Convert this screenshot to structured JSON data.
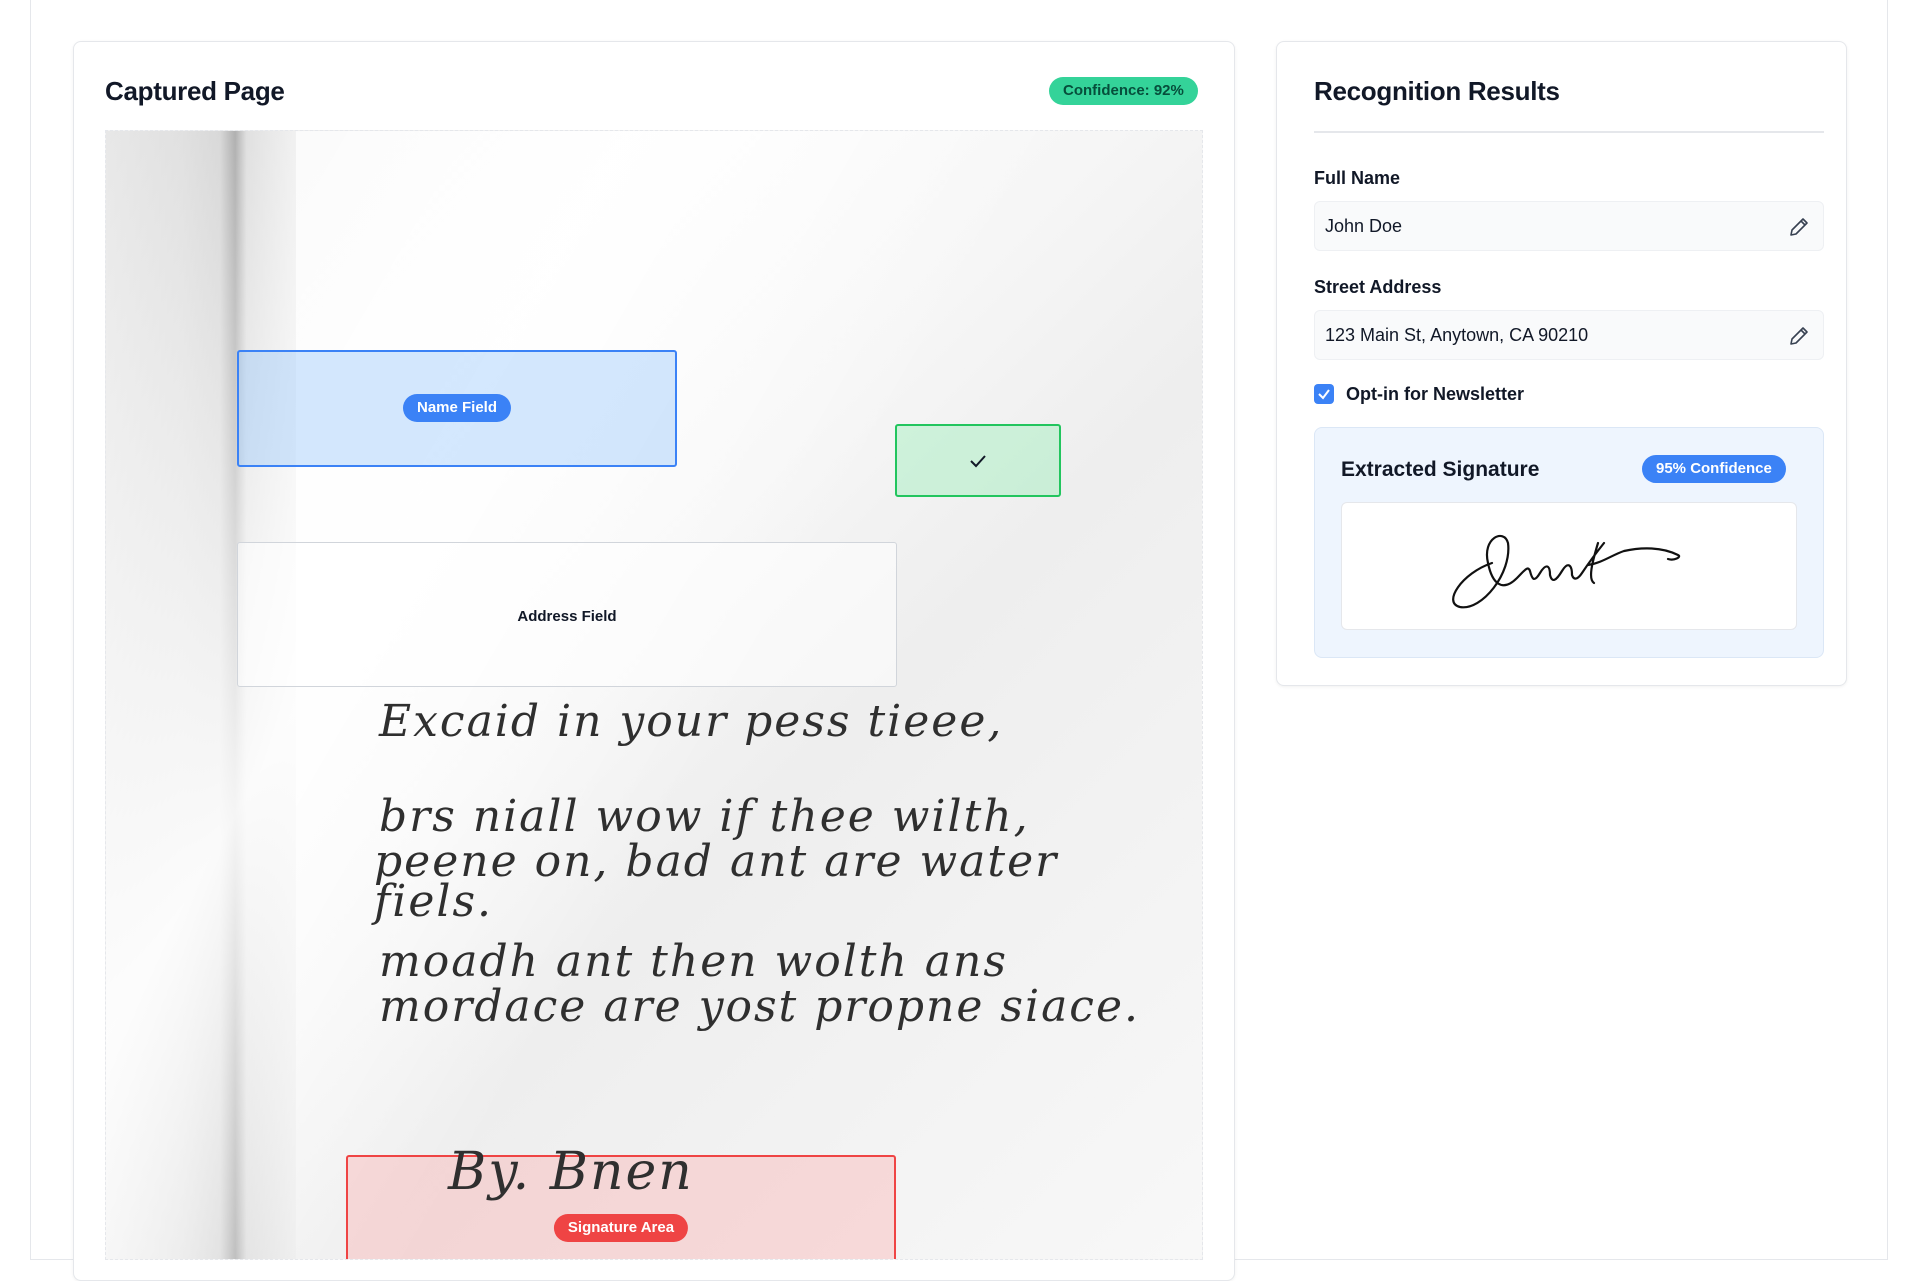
{
  "left_panel": {
    "title": "Captured Page",
    "confidence_badge": "Confidence: 92%",
    "regions": {
      "name": "Name Field",
      "address": "Address Field",
      "signature": "Signature Area"
    },
    "handwriting": [
      "Excaid in your pess tieee,",
      "brs niall wow if thee wilth,",
      "peene on, bad ant are water",
      "fiels.",
      "moadh ant then wolth ans",
      "mordace are yost propne siace.",
      "By. Bnen"
    ]
  },
  "right_panel": {
    "title": "Recognition Results",
    "fields": [
      {
        "label": "Full Name",
        "value": "John Doe"
      },
      {
        "label": "Street Address",
        "value": "123 Main St, Anytown, CA 90210"
      }
    ],
    "newsletter": {
      "label": "Opt-in for Newsletter",
      "checked": true
    },
    "signature": {
      "title": "Extracted Signature",
      "confidence": "95% Confidence",
      "script_text": "Junt"
    }
  },
  "colors": {
    "green_badge": "#34d399",
    "blue": "#3b82f6",
    "red": "#ef4444",
    "check_green": "#22c55e"
  },
  "icons": [
    "pencil-icon",
    "check-icon",
    "checkbox-checked-icon"
  ]
}
